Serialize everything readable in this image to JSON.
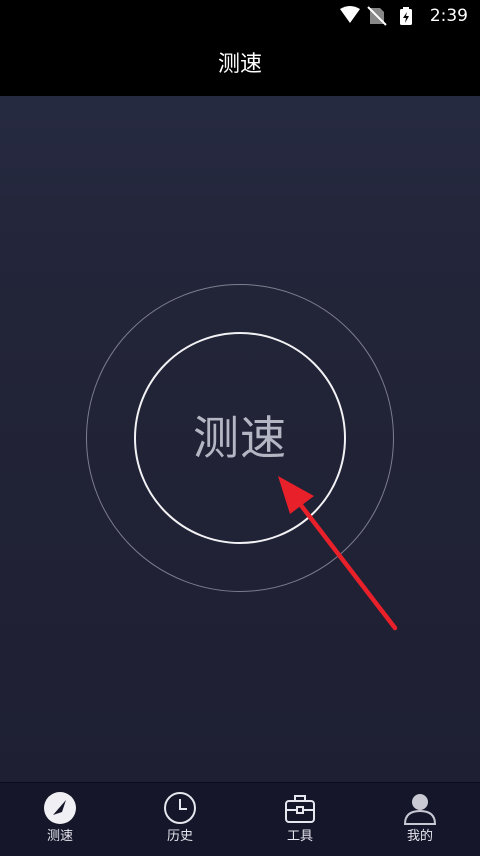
{
  "status_bar": {
    "time": "2:39"
  },
  "header": {
    "title": "测速"
  },
  "main": {
    "speed_test_button_label": "测速"
  },
  "bottom_nav": {
    "items": [
      {
        "label": "测速",
        "icon": "speedometer-icon",
        "active": true
      },
      {
        "label": "历史",
        "icon": "clock-icon",
        "active": false
      },
      {
        "label": "工具",
        "icon": "toolbox-icon",
        "active": false
      },
      {
        "label": "我的",
        "icon": "user-icon",
        "active": false
      }
    ]
  },
  "colors": {
    "background": "#1e1f33",
    "header": "#000000",
    "nav_background": "#15162a",
    "arrow": "#e8202a"
  }
}
